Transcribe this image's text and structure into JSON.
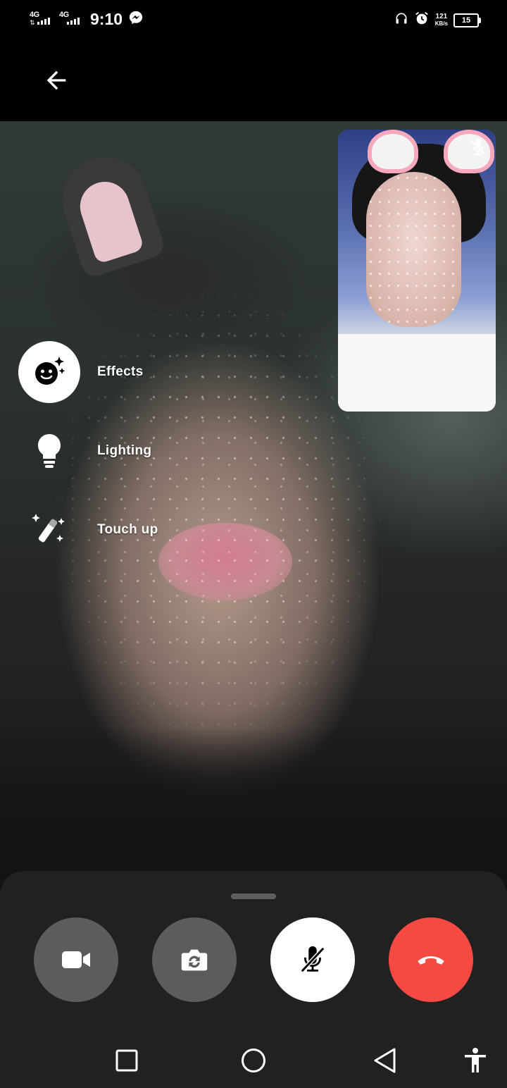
{
  "status_bar": {
    "network_1": "4G",
    "network_2": "4G",
    "time": "9:10",
    "speed_value": "121",
    "speed_unit": "KB/s",
    "battery": "15"
  },
  "top_bar": {
    "back_icon": "arrow-left-icon"
  },
  "side_menu": {
    "items": [
      {
        "label": "Effects",
        "icon": "face-sparkle-icon",
        "selected": true
      },
      {
        "label": "Lighting",
        "icon": "lightbulb-icon",
        "selected": false
      },
      {
        "label": "Touch up",
        "icon": "magic-wand-icon",
        "selected": false
      }
    ]
  },
  "self_view": {
    "mic_state_icon": "mic-off-icon"
  },
  "controls": {
    "video_icon": "video-camera-icon",
    "flip_icon": "flip-camera-icon",
    "mute_icon": "mic-off-icon",
    "end_call_icon": "hang-up-icon",
    "colors": {
      "end_call": "#f44a43",
      "button_gray": "#5c5c5c",
      "sheet": "#212121"
    }
  },
  "nav_bar": {
    "recents_icon": "square-icon",
    "home_icon": "circle-icon",
    "back_icon": "triangle-back-icon",
    "accessibility_icon": "accessibility-icon"
  }
}
